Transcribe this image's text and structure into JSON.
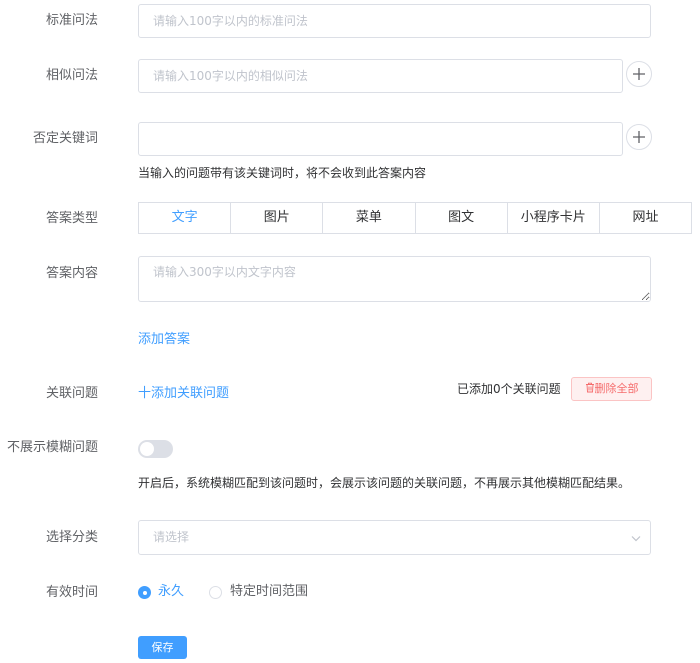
{
  "form": {
    "standard_question": {
      "label": "标准问法",
      "placeholder": "请输入100字以内的标准问法"
    },
    "similar_question": {
      "label": "相似问法",
      "placeholder": "请输入100字以内的相似问法"
    },
    "negative_keywords": {
      "label": "否定关键词",
      "placeholder": "",
      "hint": "当输入的问题带有该关键词时，将不会收到此答案内容"
    },
    "answer_type": {
      "label": "答案类型",
      "options": [
        "文字",
        "图片",
        "菜单",
        "图文",
        "小程序卡片",
        "网址"
      ],
      "selected": "文字"
    },
    "answer_content": {
      "label": "答案内容",
      "placeholder": "请输入300字以内文字内容",
      "add_link": "添加答案"
    },
    "related_questions": {
      "label": "关联问题",
      "add_link": "十添加关联问题",
      "count_text": "已添加0个关联问题",
      "delete_all_label": "删除全部"
    },
    "hide_fuzzy": {
      "label": "不展示模糊问题",
      "enabled": false,
      "hint": "开启后，系统模糊匹配到该问题时，会展示该问题的关联问题，不再展示其他模糊匹配结果。"
    },
    "category": {
      "label": "选择分类",
      "placeholder": "请选择"
    },
    "valid_time": {
      "label": "有效时间",
      "options": [
        "永久",
        "特定时间范围"
      ],
      "selected": "永久"
    },
    "save_label": "保存"
  },
  "colors": {
    "primary": "#409eff",
    "danger": "#f56c6c",
    "border": "#dcdfe6",
    "placeholder": "#c0c4cc"
  },
  "icons": {
    "add": "plus-icon",
    "delete": "trash-icon",
    "dropdown": "chevron-down-icon"
  }
}
